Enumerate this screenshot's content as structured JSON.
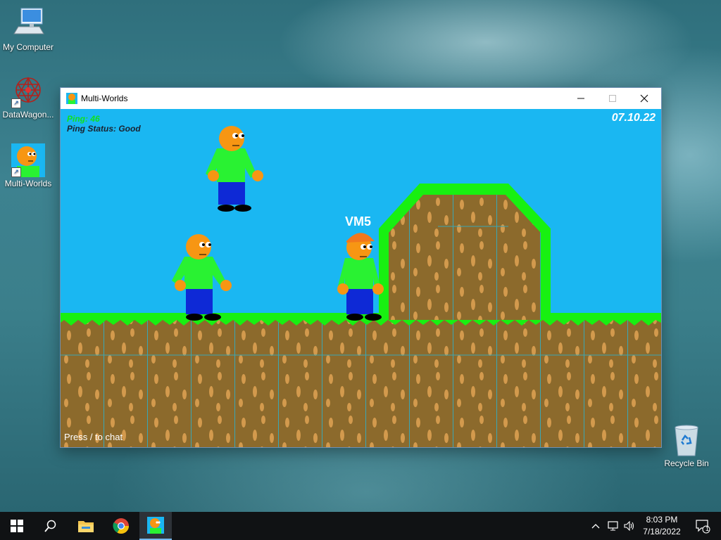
{
  "desktop": {
    "icons": [
      {
        "label": "My Computer",
        "icon": "computer-icon"
      },
      {
        "label": "DataWagon...",
        "icon": "datawagon-icon"
      },
      {
        "label": "Multi-Worlds",
        "icon": "multi-worlds-icon"
      },
      {
        "label": "Recycle Bin",
        "icon": "recycle-bin-icon"
      }
    ]
  },
  "window": {
    "title": "Multi-Worlds",
    "controls": [
      "minimize-icon",
      "maximize-icon",
      "close-icon"
    ]
  },
  "game": {
    "hud": {
      "ping": "Ping: 46",
      "ping_status": "Ping Status: Good",
      "date": "07.10.22"
    },
    "player_tag": "VM5",
    "chat_hint": "Press / to chat",
    "colors": {
      "sky": "#1ab7f2",
      "grass": "#18f011",
      "dirt": "#8c6a2c",
      "rock": "#d39a4d",
      "skin": "#f79613",
      "shirt": "#29f232",
      "pants": "#0e29d6"
    }
  },
  "taskbar": {
    "items": [
      "windows-start-icon",
      "search-icon",
      "file-explorer-icon",
      "chrome-icon",
      "multi-worlds-icon"
    ],
    "time": "8:03 PM",
    "date": "7/18/2022",
    "notification_count": "1"
  }
}
